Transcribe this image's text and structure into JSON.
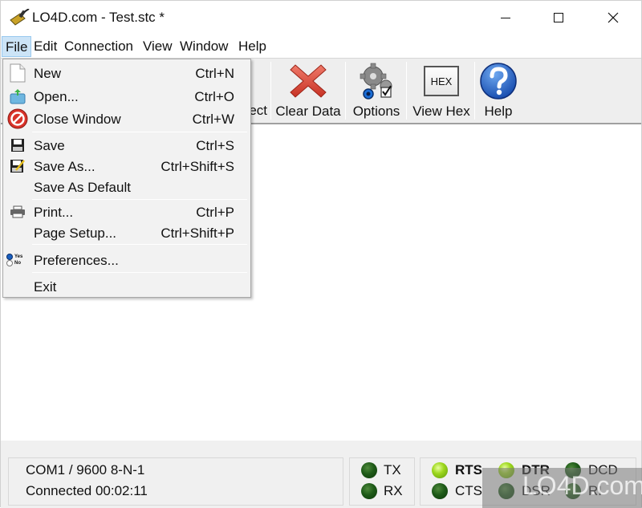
{
  "window": {
    "title": "LO4D.com - Test.stc *",
    "controls": {
      "minimize": "minimize",
      "maximize": "maximize",
      "close": "close"
    }
  },
  "menubar": {
    "items": [
      {
        "label": "File",
        "active": true
      },
      {
        "label": "Edit"
      },
      {
        "label": "Connection"
      },
      {
        "label": "View"
      },
      {
        "label": "Window"
      },
      {
        "label": "Help"
      }
    ]
  },
  "toolbar": {
    "partial_label": "ect",
    "buttons": [
      {
        "label": "Clear Data",
        "icon": "red-x-icon"
      },
      {
        "label": "Options",
        "icon": "gears-icon"
      },
      {
        "label": "View Hex",
        "icon": "hex-icon",
        "icon_text": "HEX"
      },
      {
        "label": "Help",
        "icon": "question-icon"
      }
    ]
  },
  "file_menu": {
    "items": [
      {
        "label": "New",
        "shortcut": "Ctrl+N",
        "icon": "new-document-icon"
      },
      {
        "label": "Open...",
        "shortcut": "Ctrl+O",
        "icon": "open-folder-icon"
      },
      {
        "label": "Close Window",
        "shortcut": "Ctrl+W",
        "icon": "no-entry-icon"
      },
      {
        "label": "Save",
        "shortcut": "Ctrl+S",
        "icon": "floppy-icon"
      },
      {
        "label": "Save As...",
        "shortcut": "Ctrl+Shift+S",
        "icon": "floppy-pencil-icon"
      },
      {
        "label": "Save As Default",
        "shortcut": ""
      },
      {
        "label": "Print...",
        "shortcut": "Ctrl+P",
        "icon": "printer-icon"
      },
      {
        "label": "Page Setup...",
        "shortcut": "Ctrl+Shift+P"
      },
      {
        "label": "Preferences...",
        "shortcut": "",
        "icon": "radio-yes-no-icon",
        "icon_yes": "Yes",
        "icon_no": "No"
      },
      {
        "label": "Exit",
        "shortcut": ""
      }
    ]
  },
  "status": {
    "port": "COM1 / 9600 8-N-1",
    "connection": "Connected 00:02:11",
    "leds": {
      "tx": {
        "label": "TX",
        "on": false
      },
      "rx": {
        "label": "RX",
        "on": false
      },
      "rts": {
        "label": "RTS",
        "on": true
      },
      "cts": {
        "label": "CTS",
        "on": false
      },
      "dtr": {
        "label": "DTR",
        "on": true
      },
      "dsr": {
        "label": "DSR",
        "on": false
      },
      "dcd": {
        "label": "DCD",
        "on": false
      },
      "ri": {
        "label": "RI",
        "on": false
      }
    }
  },
  "watermark": {
    "text": "LO4D.com"
  }
}
